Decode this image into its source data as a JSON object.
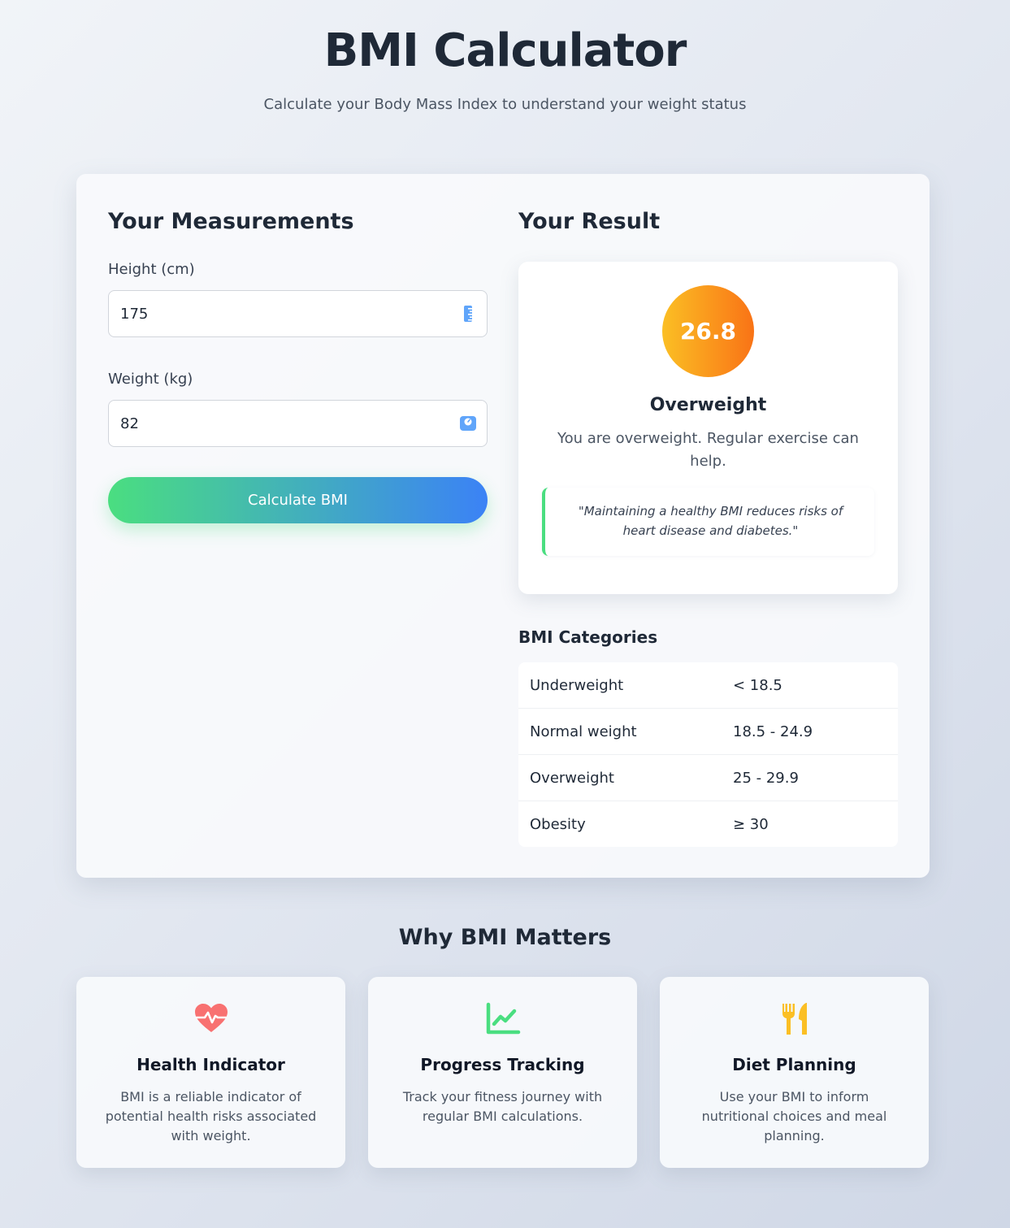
{
  "header": {
    "title": "BMI Calculator",
    "subtitle": "Calculate your Body Mass Index to understand your weight status"
  },
  "measurements": {
    "section_title": "Your Measurements",
    "height_label": "Height (cm)",
    "height_value": "175",
    "height_icon": "ruler-icon",
    "weight_label": "Weight (kg)",
    "weight_value": "82",
    "weight_icon": "scale-icon",
    "calculate_label": "Calculate BMI"
  },
  "result": {
    "section_title": "Your Result",
    "bmi_value": "26.8",
    "status": "Overweight",
    "description": "You are overweight. Regular exercise can help.",
    "quote": "\"Maintaining a healthy BMI reduces risks of heart disease and diabetes.\""
  },
  "categories": {
    "title": "BMI Categories",
    "rows": [
      {
        "name": "Underweight",
        "range": "< 18.5"
      },
      {
        "name": "Normal weight",
        "range": "18.5 - 24.9"
      },
      {
        "name": "Overweight",
        "range": "25 - 29.9"
      },
      {
        "name": "Obesity",
        "range": "≥ 30"
      }
    ]
  },
  "why": {
    "title": "Why BMI Matters",
    "cards": [
      {
        "icon": "heart-pulse-icon",
        "title": "Health Indicator",
        "description": "BMI is a reliable indicator of potential health risks associated with weight."
      },
      {
        "icon": "chart-line-icon",
        "title": "Progress Tracking",
        "description": "Track your fitness journey with regular BMI calculations."
      },
      {
        "icon": "utensils-icon",
        "title": "Diet Planning",
        "description": "Use your BMI to inform nutritional choices and meal planning."
      }
    ]
  },
  "colors": {
    "button_gradient_start": "#4ade80",
    "button_gradient_end": "#3b82f6",
    "bmi_circle_start": "#fbbf24",
    "bmi_circle_end": "#f97316",
    "heart_icon": "#f87171",
    "chart_icon": "#4ade80",
    "utensils_icon": "#fbbf24"
  }
}
